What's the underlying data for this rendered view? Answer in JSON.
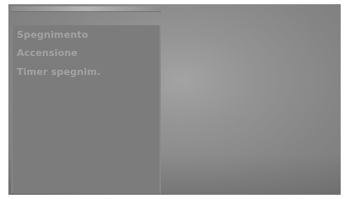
{
  "menu": {
    "items": [
      {
        "label": "Spegnimento"
      },
      {
        "label": "Accensione"
      },
      {
        "label": "Timer spegnim."
      }
    ]
  }
}
